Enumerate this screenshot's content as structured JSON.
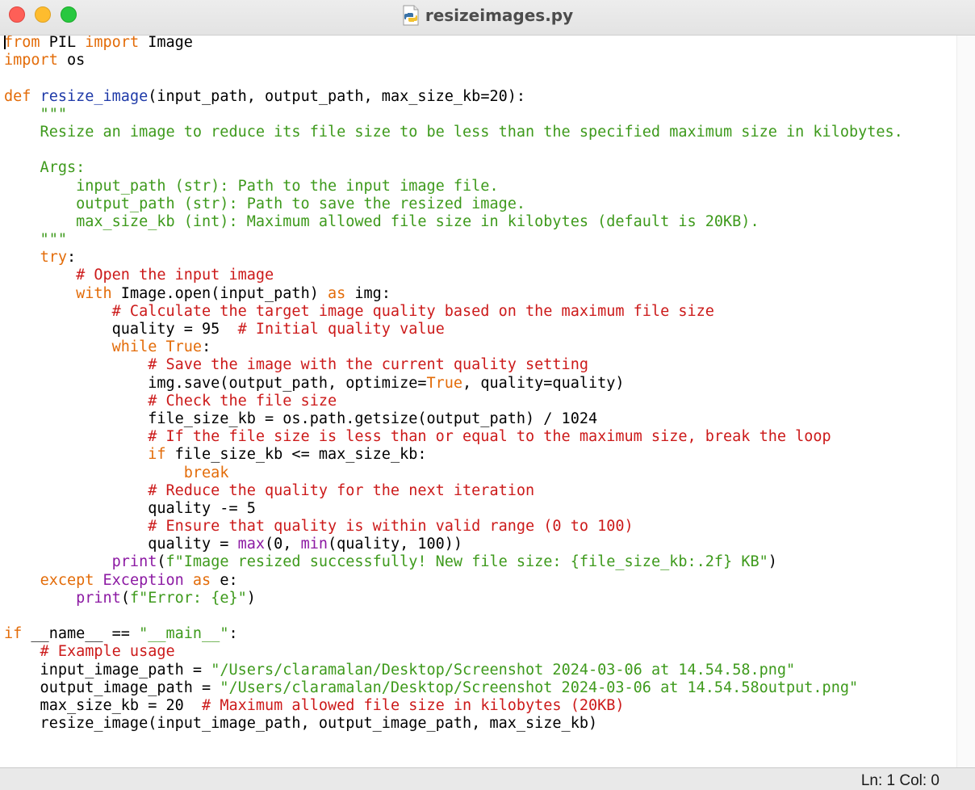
{
  "window": {
    "title": "resizeimages.py",
    "file_icon": "python-file-icon",
    "controls": [
      "close",
      "minimize",
      "maximize"
    ]
  },
  "colors": {
    "keyword": "#e36c09",
    "function_name": "#1f3aa8",
    "string": "#3e9a1c",
    "comment": "#cc1a1a",
    "builtin": "#8c1aa3",
    "plain": "#000000"
  },
  "editor": {
    "lines": [
      [
        {
          "t": "from",
          "c": "kw"
        },
        {
          "t": " PIL "
        },
        {
          "t": "import",
          "c": "kw"
        },
        {
          "t": " Image"
        }
      ],
      [
        {
          "t": "import",
          "c": "kw"
        },
        {
          "t": " os"
        }
      ],
      [],
      [
        {
          "t": "def",
          "c": "kw"
        },
        {
          "t": " "
        },
        {
          "t": "resize_image",
          "c": "fn"
        },
        {
          "t": "(input_path, output_path, max_size_kb=20):"
        }
      ],
      [
        {
          "t": "    \"\"\"",
          "c": "str"
        }
      ],
      [
        {
          "t": "    Resize an image to reduce its file size to be less than the specified maximum size in kilobytes.",
          "c": "str"
        }
      ],
      [],
      [
        {
          "t": "    Args:",
          "c": "str"
        }
      ],
      [
        {
          "t": "        input_path (str): Path to the input image file.",
          "c": "str"
        }
      ],
      [
        {
          "t": "        output_path (str): Path to save the resized image.",
          "c": "str"
        }
      ],
      [
        {
          "t": "        max_size_kb (int): Maximum allowed file size in kilobytes (default is 20KB).",
          "c": "str"
        }
      ],
      [
        {
          "t": "    \"\"\"",
          "c": "str"
        }
      ],
      [
        {
          "t": "    "
        },
        {
          "t": "try",
          "c": "kw"
        },
        {
          "t": ":"
        }
      ],
      [
        {
          "t": "        # Open the input image",
          "c": "cm"
        }
      ],
      [
        {
          "t": "        "
        },
        {
          "t": "with",
          "c": "kw"
        },
        {
          "t": " Image.open(input_path) "
        },
        {
          "t": "as",
          "c": "kw"
        },
        {
          "t": " img:"
        }
      ],
      [
        {
          "t": "            # Calculate the target image quality based on the maximum file size",
          "c": "cm"
        }
      ],
      [
        {
          "t": "            quality = 95  "
        },
        {
          "t": "# Initial quality value",
          "c": "cm"
        }
      ],
      [
        {
          "t": "            "
        },
        {
          "t": "while",
          "c": "kw"
        },
        {
          "t": " "
        },
        {
          "t": "True",
          "c": "kw"
        },
        {
          "t": ":"
        }
      ],
      [
        {
          "t": "                # Save the image with the current quality setting",
          "c": "cm"
        }
      ],
      [
        {
          "t": "                img.save(output_path, optimize="
        },
        {
          "t": "True",
          "c": "kw"
        },
        {
          "t": ", quality=quality)"
        }
      ],
      [
        {
          "t": "                # Check the file size",
          "c": "cm"
        }
      ],
      [
        {
          "t": "                file_size_kb = os.path.getsize(output_path) / 1024"
        }
      ],
      [
        {
          "t": "                # If the file size is less than or equal to the maximum size, break the loop",
          "c": "cm"
        }
      ],
      [
        {
          "t": "                "
        },
        {
          "t": "if",
          "c": "kw"
        },
        {
          "t": " file_size_kb <= max_size_kb:"
        }
      ],
      [
        {
          "t": "                    "
        },
        {
          "t": "break",
          "c": "kw"
        }
      ],
      [
        {
          "t": "                # Reduce the quality for the next iteration",
          "c": "cm"
        }
      ],
      [
        {
          "t": "                quality -= 5"
        }
      ],
      [
        {
          "t": "                # Ensure that quality is within valid range (0 to 100)",
          "c": "cm"
        }
      ],
      [
        {
          "t": "                quality = "
        },
        {
          "t": "max",
          "c": "bi"
        },
        {
          "t": "(0, "
        },
        {
          "t": "min",
          "c": "bi"
        },
        {
          "t": "(quality, 100))"
        }
      ],
      [
        {
          "t": "            "
        },
        {
          "t": "print",
          "c": "bi"
        },
        {
          "t": "("
        },
        {
          "t": "f\"Image resized successfully! New file size: {file_size_kb:.2f} KB\"",
          "c": "str"
        },
        {
          "t": ")"
        }
      ],
      [
        {
          "t": "    "
        },
        {
          "t": "except",
          "c": "kw"
        },
        {
          "t": " "
        },
        {
          "t": "Exception",
          "c": "bi"
        },
        {
          "t": " "
        },
        {
          "t": "as",
          "c": "kw"
        },
        {
          "t": " e:"
        }
      ],
      [
        {
          "t": "        "
        },
        {
          "t": "print",
          "c": "bi"
        },
        {
          "t": "("
        },
        {
          "t": "f\"Error: {e}\"",
          "c": "str"
        },
        {
          "t": ")"
        }
      ],
      [],
      [
        {
          "t": "if",
          "c": "kw"
        },
        {
          "t": " __name__ == "
        },
        {
          "t": "\"__main__\"",
          "c": "str"
        },
        {
          "t": ":"
        }
      ],
      [
        {
          "t": "    # Example usage",
          "c": "cm"
        }
      ],
      [
        {
          "t": "    input_image_path = "
        },
        {
          "t": "\"/Users/claramalan/Desktop/Screenshot 2024-03-06 at 14.54.58.png\"",
          "c": "str"
        }
      ],
      [
        {
          "t": "    output_image_path = "
        },
        {
          "t": "\"/Users/claramalan/Desktop/Screenshot 2024-03-06 at 14.54.58output.png\"",
          "c": "str"
        }
      ],
      [
        {
          "t": "    max_size_kb = 20  "
        },
        {
          "t": "# Maximum allowed file size in kilobytes (20KB)",
          "c": "cm"
        }
      ],
      [
        {
          "t": "    resize_image(input_image_path, output_image_path, max_size_kb)"
        }
      ]
    ]
  },
  "status": {
    "position": "Ln: 1  Col: 0"
  }
}
